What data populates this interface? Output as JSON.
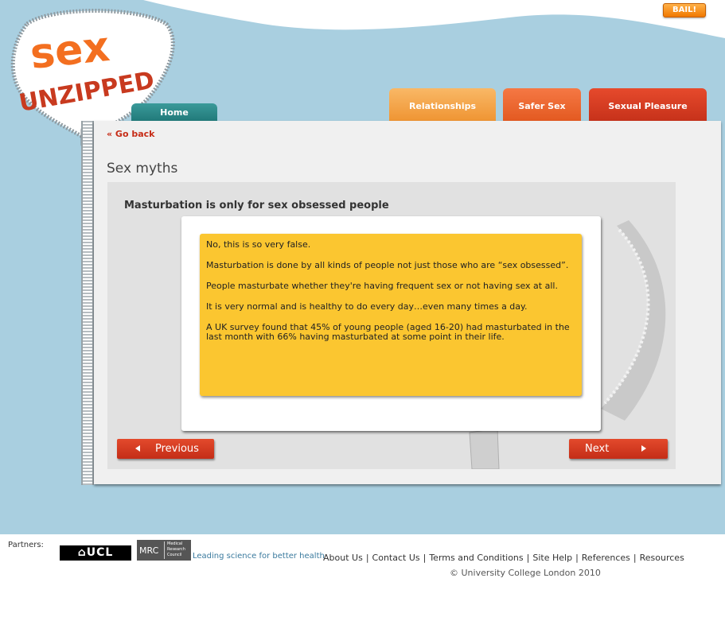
{
  "header": {
    "bail_label": "BAIL!",
    "logo_alt": "Sex Unzipped"
  },
  "nav": {
    "home": "Home",
    "relationships": "Relationships",
    "safer_sex": "Safer Sex",
    "sexual_pleasure": "Sexual Pleasure"
  },
  "content": {
    "go_back": "« Go back",
    "page_title": "Sex myths",
    "question": "Masturbation is only for sex obsessed people",
    "answer": [
      "No, this is so very false.",
      "Masturbation is done by all kinds of people not just those who are “sex obsessed”.",
      "People masturbate whether they're having frequent sex or not having sex at all.",
      "It is very normal and is healthy to do every day…even many times a day.",
      "A UK survey found that 45% of young people (aged 16-20) had masturbated in the last month with 66% having masturbated at some point in their life."
    ],
    "prev_label": "Previous",
    "next_label": "Next"
  },
  "footer": {
    "partners_label": "Partners:",
    "ucl_label": "⌂UCL",
    "mrc_label": "MRC",
    "mrc_sub": "Medical Research Council",
    "tagline": "Leading science for better health",
    "links": [
      "About Us",
      "Contact Us",
      "Terms and Conditions",
      "Site Help",
      "References",
      "Resources"
    ],
    "copyright": "© University College London 2010"
  },
  "colors": {
    "sky": "#a9cfe0",
    "home_tab": "#1f7777",
    "relationships_tab": "#ef9432",
    "safer_tab": "#e35920",
    "pleasure_tab": "#c6311a",
    "answer_box": "#fbc630",
    "button_red": "#c42d17",
    "link_red": "#c62b16"
  }
}
